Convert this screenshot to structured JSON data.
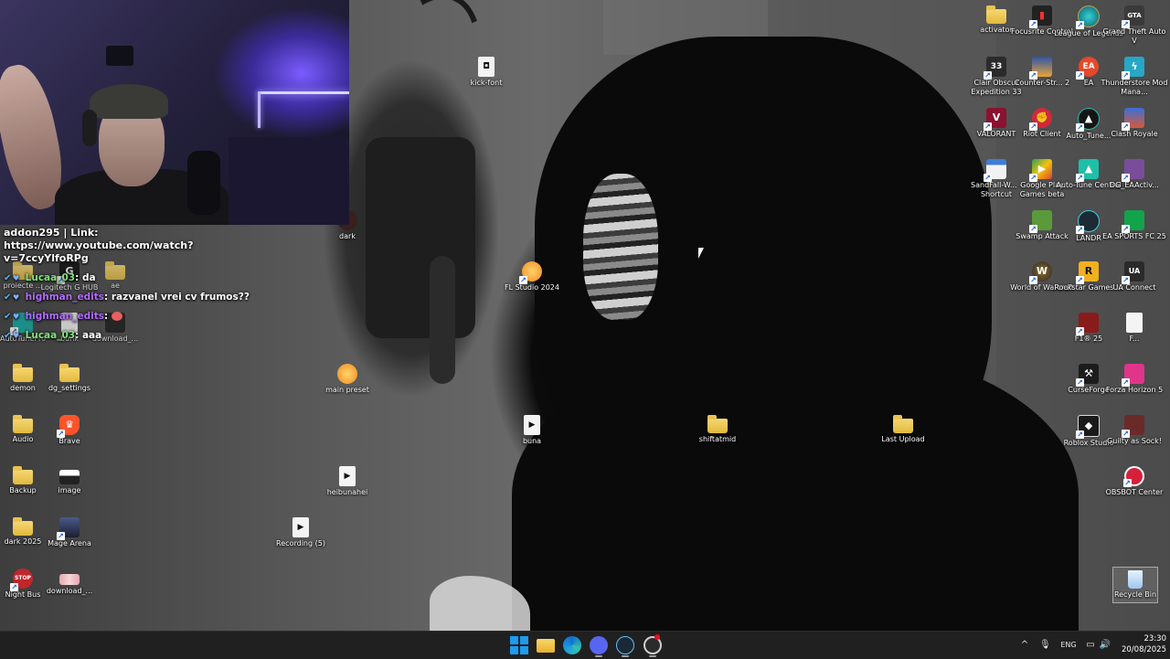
{
  "desktop": {
    "icons_left": [
      {
        "label": "demon",
        "type": "folder",
        "icon": "folder-icon"
      },
      {
        "label": "dg_settings",
        "type": "folder",
        "icon": "folder-icon"
      },
      {
        "label": "Audio",
        "type": "folder",
        "icon": "folder-icon"
      },
      {
        "label": "Brave",
        "type": "app",
        "icon": "brave-icon",
        "color": "#fb542b"
      },
      {
        "label": "Backup",
        "type": "folder",
        "icon": "folder-icon"
      },
      {
        "label": "image",
        "type": "image",
        "icon": "image-icon"
      },
      {
        "label": "dark 2025",
        "type": "folder",
        "icon": "folder-icon"
      },
      {
        "label": "Mage Arena",
        "type": "app",
        "icon": "mage-arena-icon",
        "color": "#2a2f45"
      },
      {
        "label": "Night Bus",
        "type": "app",
        "icon": "night-bus-icon",
        "color": "#c0262b"
      },
      {
        "label": "download_...",
        "type": "image",
        "icon": "image-icon"
      }
    ],
    "icons_partial": [
      {
        "label": "proiecte ...",
        "icon": "folder-icon"
      },
      {
        "label": "Logitech G HUB",
        "icon": "logitech-icon"
      },
      {
        "label": "ae",
        "icon": "folder-icon"
      },
      {
        "label": "AutoTunePro",
        "icon": "autotune-icon"
      },
      {
        "label": "bunk",
        "icon": "file-icon"
      },
      {
        "label": "download_...",
        "icon": "image-icon"
      },
      {
        "label": "dark",
        "icon": "dark-icon"
      }
    ],
    "icons_middle": [
      {
        "label": "kick-font",
        "icon": "discord-file-icon"
      },
      {
        "label": "FL Studio 2024",
        "icon": "fl-studio-icon",
        "color": "#f28c1e"
      },
      {
        "label": "main preset",
        "icon": "fl-studio-icon",
        "color": "#f28c1e"
      },
      {
        "label": "buna",
        "icon": "media-file-icon"
      },
      {
        "label": "shiftatmid",
        "icon": "folder-icon"
      },
      {
        "label": "Last Upload",
        "icon": "folder-icon"
      },
      {
        "label": "heibunahei",
        "icon": "media-file-icon"
      },
      {
        "label": "Recording (5)",
        "icon": "media-file-icon"
      }
    ],
    "icons_right": [
      {
        "label": "activator",
        "icon": "folder-icon",
        "color": "#e7b93c"
      },
      {
        "label": "Focusrite Control",
        "icon": "focusrite-icon",
        "color": "#222222"
      },
      {
        "label": "League of Legends",
        "icon": "league-icon",
        "color": "#0a8f9c"
      },
      {
        "label": "Grand Theft Auto V",
        "icon": "gta-icon",
        "color": "#3a3a3a"
      },
      {
        "label": "Clair Obscur Expedition 33",
        "icon": "clair-obscur-icon",
        "color": "#2b2b2b"
      },
      {
        "label": "Counter-Str... 2",
        "icon": "counter-strike-icon",
        "color": "#e6a33a"
      },
      {
        "label": "EA",
        "icon": "ea-icon",
        "color": "#e6482a"
      },
      {
        "label": "Thunderstore Mod Mana...",
        "icon": "thunderstore-icon",
        "color": "#27a7c6"
      },
      {
        "label": "VALORANT",
        "icon": "valorant-icon",
        "color": "#8a1230"
      },
      {
        "label": "Riot Client",
        "icon": "riot-icon",
        "color": "#d1293b"
      },
      {
        "label": "Auto_Tune...",
        "icon": "autotune-icon",
        "color": "#151515"
      },
      {
        "label": "Clash Royale",
        "icon": "clash-royale-icon",
        "color": "#3b6fd6"
      },
      {
        "label": "SandFall-W... - Shortcut",
        "icon": "window-file-icon",
        "color": "#3d7dd8"
      },
      {
        "label": "Google Play Games beta",
        "icon": "google-play-icon",
        "color": "#2f9e5a"
      },
      {
        "label": "Auto-Tune Central",
        "icon": "autotune-central-icon",
        "color": "#1fbfa9"
      },
      {
        "label": "DG_EAActiv...",
        "icon": "dg-icon",
        "color": "#7a4d9a"
      },
      {
        "label": "Swamp Attack",
        "icon": "swamp-attack-icon",
        "color": "#5a9a3a"
      },
      {
        "label": "LANDR",
        "icon": "landr-icon",
        "color": "#1b2a33"
      },
      {
        "label": "EA SPORTS FC 25",
        "icon": "fc25-icon",
        "color": "#13a34b"
      },
      {
        "label": "World of Warcraft",
        "icon": "wow-icon",
        "color": "#3b3b3b"
      },
      {
        "label": "Rockstar Games ...",
        "icon": "rockstar-icon",
        "color": "#f0b020"
      },
      {
        "label": "UA Connect",
        "icon": "ua-icon",
        "color": "#2a2a2a"
      },
      {
        "label": "F1® 25",
        "icon": "f1-icon",
        "color": "#8a1b1b"
      },
      {
        "label": "F...",
        "icon": "file-icon",
        "color": "#f2f2f2"
      },
      {
        "label": "CurseForge",
        "icon": "curseforge-icon",
        "color": "#1c1c1c"
      },
      {
        "label": "Forza Horizon 5",
        "icon": "forza-icon",
        "color": "#e0358a"
      },
      {
        "label": "Roblox Studio",
        "icon": "roblox-studio-icon",
        "color": "#1a1a1a"
      },
      {
        "label": "Guilty as Sock!",
        "icon": "guilty-as-sock-icon",
        "color": "#6a2a2a"
      },
      {
        "label": "OBSBOT Center",
        "icon": "obsbot-icon",
        "color": "#d6203a"
      },
      {
        "label": "Recycle Bin",
        "icon": "recycle-bin-icon",
        "color": "#9ec6ea"
      }
    ]
  },
  "chat": {
    "first_user": "addon295",
    "first_message": "| Link: https://www.youtube.com/watch?v=7ccyYlfoRPg",
    "lines": [
      {
        "user": "Lucaa_03",
        "sep": ":",
        "text": "da",
        "user_color": "#7fe37a"
      },
      {
        "user": "highman_edits",
        "sep": ":",
        "text": "razvanel vrei cv frumos??",
        "user_color": "#b26cff"
      },
      {
        "user": "highman_edits",
        "sep": ":",
        "text": "",
        "user_color": "#b26cff",
        "emote": "heart-emote"
      },
      {
        "user": "Lucaa_03",
        "sep": ":",
        "text": "aaa",
        "user_color": "#7fe37a"
      }
    ]
  },
  "taskbar": {
    "apps": [
      {
        "name": "start",
        "icon": "windows-start-icon"
      },
      {
        "name": "file-explorer",
        "icon": "folder-icon"
      },
      {
        "name": "edge",
        "icon": "edge-icon"
      },
      {
        "name": "discord",
        "icon": "discord-icon"
      },
      {
        "name": "steam",
        "icon": "steam-icon"
      },
      {
        "name": "obs",
        "icon": "obs-icon"
      }
    ],
    "tray": {
      "chevron": "^",
      "mic": "🎙",
      "language": "ENG",
      "network": "▭",
      "volume": "🔊"
    },
    "time": "23:30",
    "date": "20/08/2025"
  },
  "colors": {
    "taskbar_bg": "#202020",
    "accent": "#1c9bf0",
    "chat_green": "#7fe37a",
    "chat_purple": "#b26cff"
  }
}
